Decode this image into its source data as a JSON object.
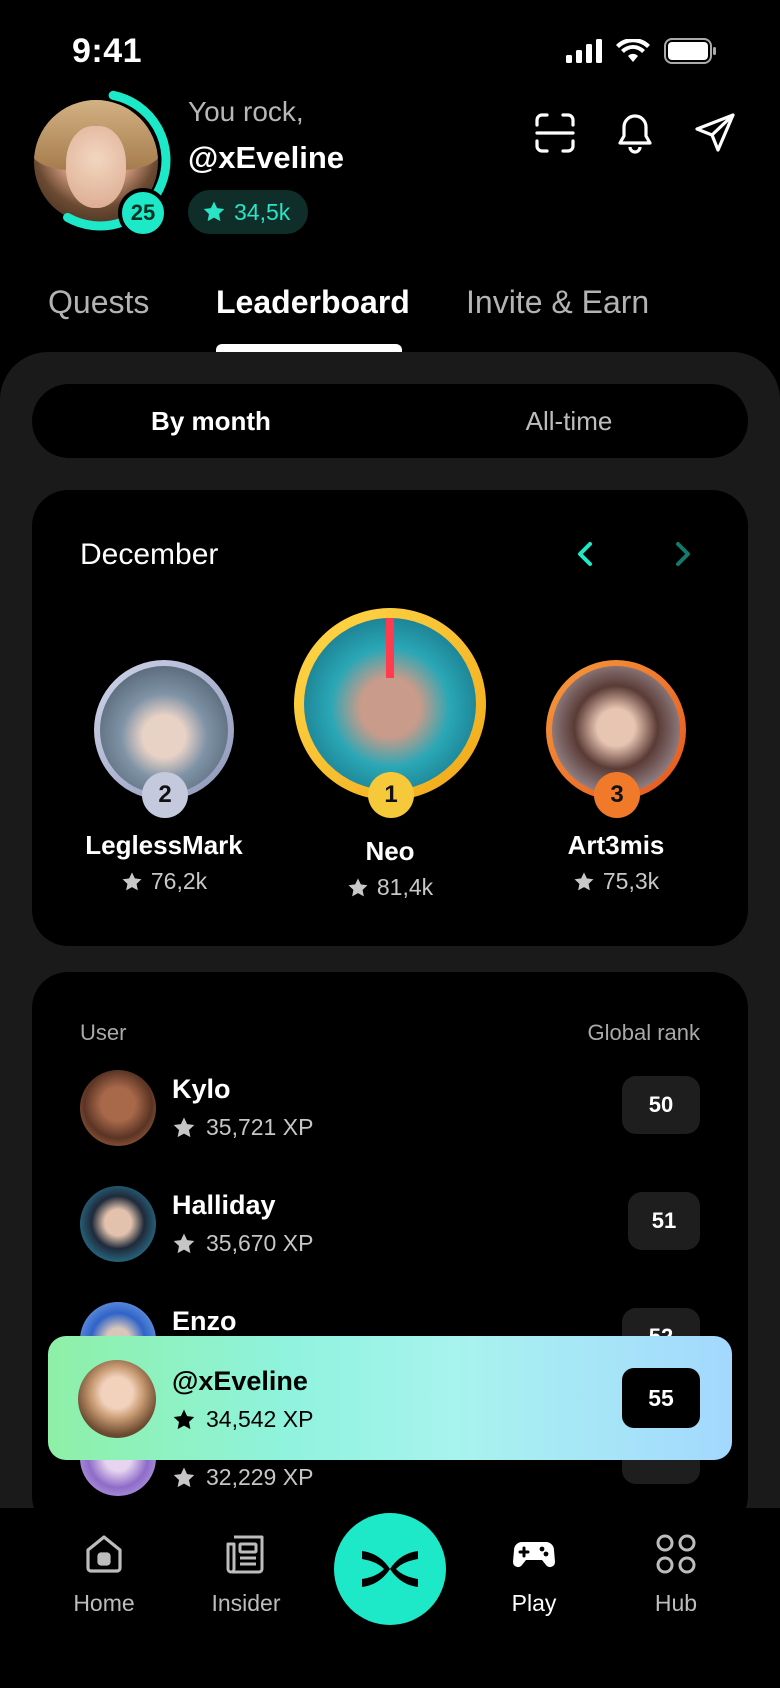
{
  "status_bar": {
    "time": "9:41"
  },
  "header": {
    "greeting": "You rock,",
    "username": "@xEveline",
    "level": "25",
    "points": "34,5k",
    "level_progress": 0.55
  },
  "tabs": [
    {
      "label": "Quests",
      "active": false
    },
    {
      "label": "Leaderboard",
      "active": true
    },
    {
      "label": "Invite & Earn",
      "active": false
    }
  ],
  "period_toggle": {
    "options": [
      "By month",
      "All-time"
    ],
    "selected": "By month"
  },
  "podium": {
    "month": "December",
    "winners": [
      {
        "rank": "2",
        "name": "LeglessMark",
        "points": "76,2k"
      },
      {
        "rank": "1",
        "name": "Neo",
        "points": "81,4k"
      },
      {
        "rank": "3",
        "name": "Art3mis",
        "points": "75,3k"
      }
    ]
  },
  "leaderboard": {
    "col_user": "User",
    "col_rank": "Global rank",
    "rows": [
      {
        "name": "Kylo",
        "xp": "35,721 XP",
        "rank": "50"
      },
      {
        "name": "Halliday",
        "xp": "35,670 XP",
        "rank": "51"
      },
      {
        "name": "Enzo",
        "xp": "",
        "rank": "52"
      },
      {
        "name": "",
        "xp": "32,229 XP",
        "rank": ""
      }
    ]
  },
  "my_rank": {
    "name": "@xEveline",
    "xp": "34,542 XP",
    "rank": "55"
  },
  "bottom_nav": {
    "items": [
      {
        "label": "Home",
        "icon": "home-icon"
      },
      {
        "label": "Insider",
        "icon": "newspaper-icon"
      },
      {
        "label": "Play",
        "icon": "gamepad-icon",
        "active": true
      },
      {
        "label": "Hub",
        "icon": "grid-icon"
      }
    ]
  },
  "colors": {
    "accent": "#1de9c8",
    "gold": "#f5c93a",
    "silver": "#c4c9de",
    "bronze": "#f07a2a"
  }
}
